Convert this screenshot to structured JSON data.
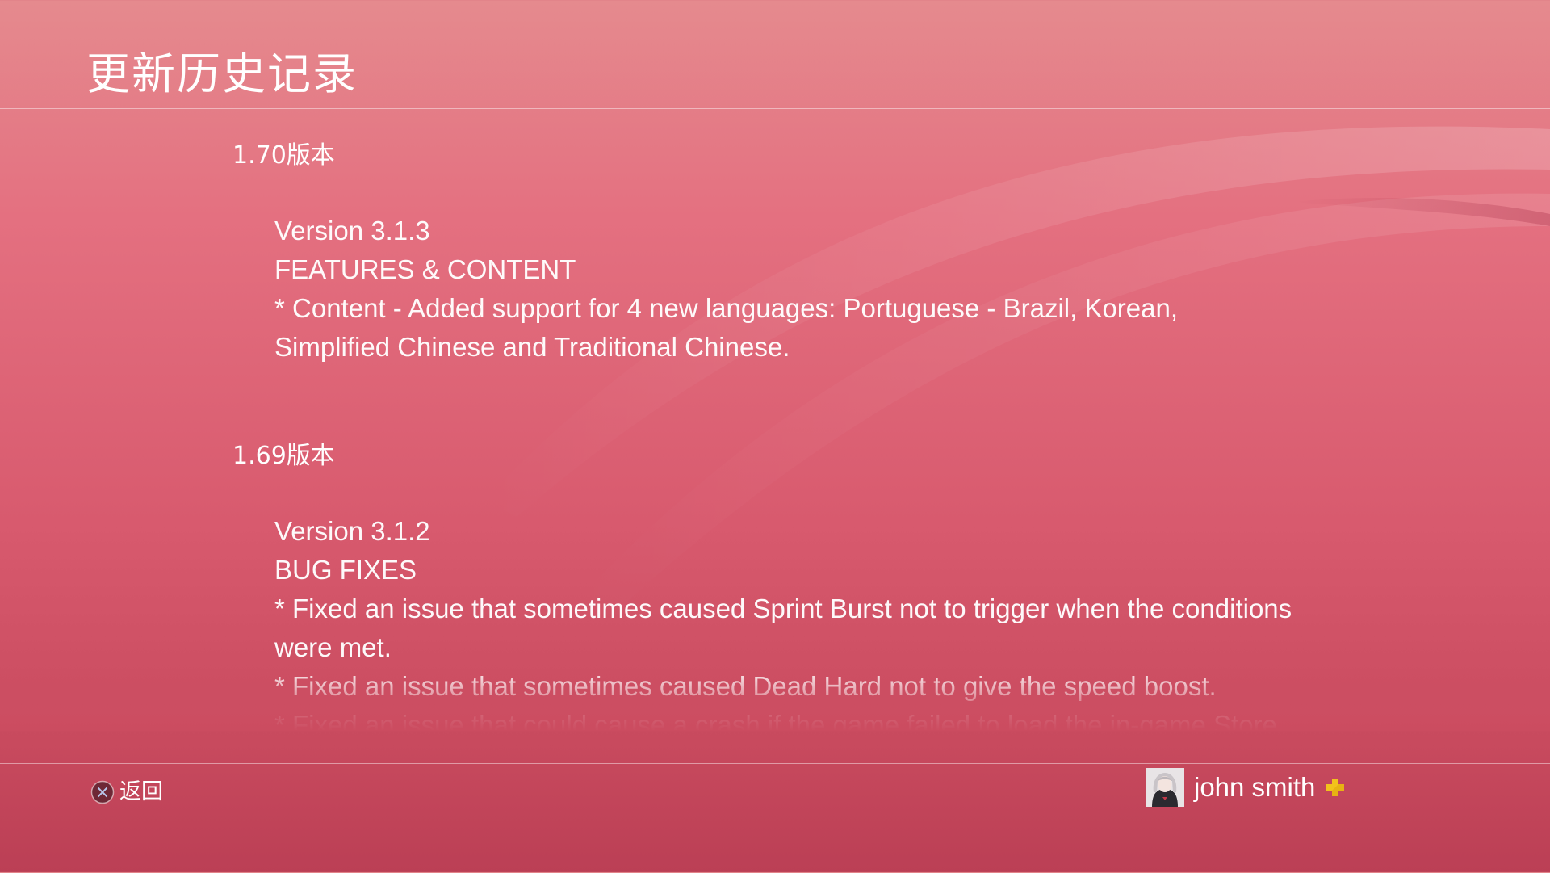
{
  "header": {
    "title": "更新历史记录"
  },
  "entries": [
    {
      "heading": "1.70版本",
      "lines": [
        "Version 3.1.3",
        "FEATURES & CONTENT",
        "* Content - Added support for 4 new languages: Portuguese - Brazil, Korean,",
        "Simplified Chinese and Traditional Chinese."
      ]
    },
    {
      "heading": "1.69版本",
      "lines": [
        "Version 3.1.2",
        "BUG FIXES",
        "* Fixed an issue that sometimes caused Sprint Burst not to trigger when the conditions",
        "were met.",
        "* Fixed an issue that sometimes caused Dead Hard not to give the speed boost.",
        "* Fixed an issue that could cause a crash if the game failed to load the in-game Store"
      ]
    }
  ],
  "footer": {
    "back_label": "返回",
    "back_icon": "cross-button-icon",
    "user": {
      "name": "john smith",
      "avatar_icon": "avatar",
      "membership_icon": "playstation-plus-icon",
      "membership_color": "#f2c21b"
    }
  }
}
